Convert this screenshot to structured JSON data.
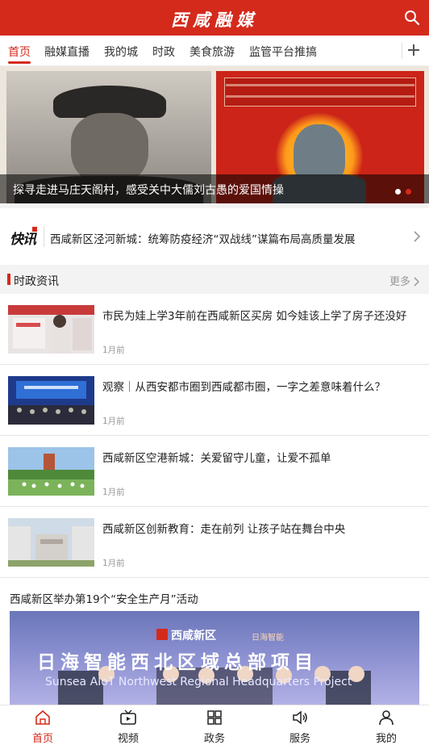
{
  "header": {
    "app_title": "西咸融媒",
    "search_icon": "search-icon",
    "accent_color": "#d42a1c"
  },
  "tabs": {
    "items": [
      {
        "label": "首页",
        "active": true
      },
      {
        "label": "融媒直播",
        "active": false
      },
      {
        "label": "我的城",
        "active": false
      },
      {
        "label": "时政",
        "active": false
      },
      {
        "label": "美食旅游",
        "active": false
      },
      {
        "label": "监管平台推搞",
        "active": false
      }
    ],
    "add_icon": "plus-icon"
  },
  "banner": {
    "caption": "探寻走进马庄天阁村，感受关中大儒刘古愚的爱国情操",
    "slide_count": 2,
    "active_slide": 2
  },
  "flash_news": {
    "logo": "快讯",
    "text": "西咸新区泾河新城：统筹防疫经济“双战线”谋篇布局高质量发展",
    "arrow_icon": "chevron-right-icon"
  },
  "section": {
    "title": "时政资讯",
    "more_label": "更多"
  },
  "news": [
    {
      "title": "市民为娃上学3年前在西咸新区买房 如今娃该上学了房子还没好",
      "time": "1月前"
    },
    {
      "title": "观察｜从西安都市圈到西咸都市圈，一字之差意味着什么？",
      "time": "1月前"
    },
    {
      "title": "西咸新区空港新城：关爱留守儿童，让爱不孤单",
      "time": "1月前"
    },
    {
      "title": "西咸新区创新教育：走在前列 让孩子站在舞台中央",
      "time": "1月前"
    }
  ],
  "feature": {
    "title": "西咸新区举办第19个“安全生产月”活动",
    "image_banner_text": "日海智能西北区域总部项目",
    "image_banner_text_en": "Sunsea AIoT Northwest Regional Headquarters Project",
    "image_logo_text": "西咸新区",
    "image_logo_text_2": "日海智能"
  },
  "bottom_nav": [
    {
      "label": "首页",
      "icon": "home-icon",
      "active": true
    },
    {
      "label": "视频",
      "icon": "tv-icon",
      "active": false
    },
    {
      "label": "政务",
      "icon": "grid-icon",
      "active": false
    },
    {
      "label": "服务",
      "icon": "speaker-icon",
      "active": false
    },
    {
      "label": "我的",
      "icon": "user-icon",
      "active": false
    }
  ]
}
